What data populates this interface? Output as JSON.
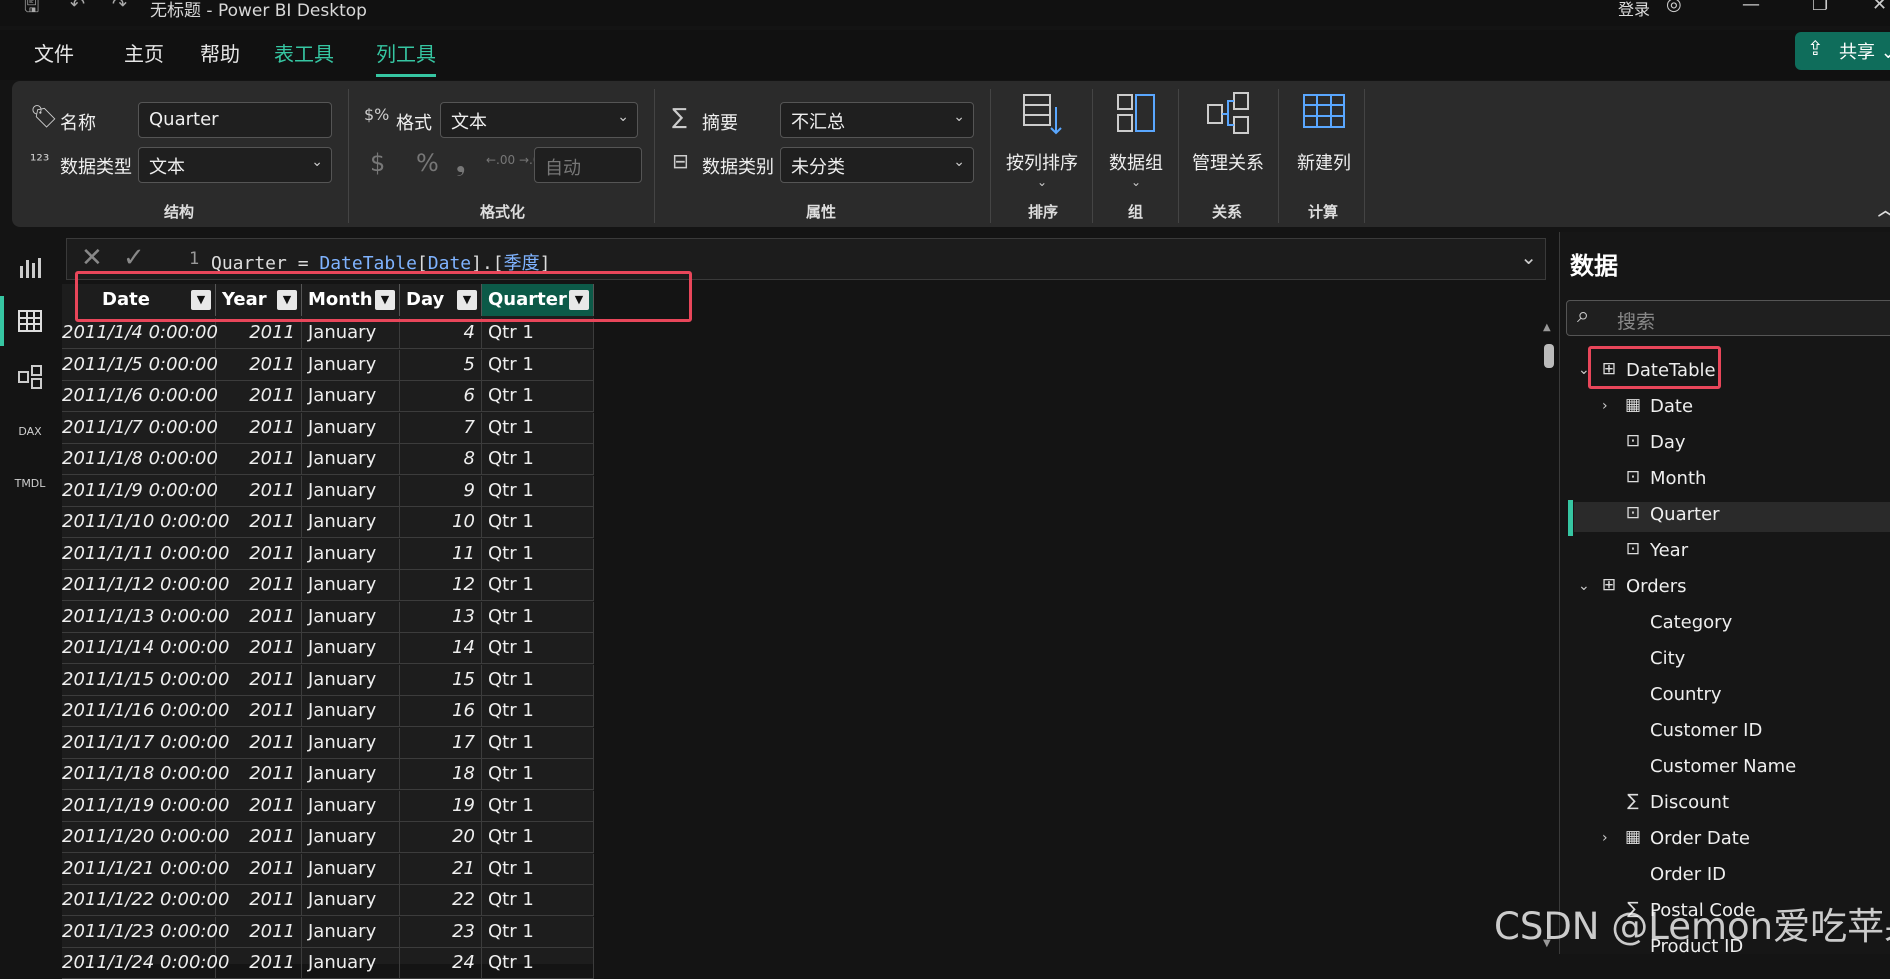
{
  "window": {
    "title": "无标题 - Power BI Desktop",
    "login": "登录",
    "icons": [
      "save-icon",
      "undo-icon",
      "redo-icon"
    ],
    "min": "—",
    "max": "❐",
    "close": "✕"
  },
  "menu": {
    "file": "文件",
    "home": "主页",
    "help": "帮助",
    "table_tools": "表工具",
    "column_tools": "列工具"
  },
  "share": {
    "label": "共享",
    "chevron": "⌄"
  },
  "ribbon": {
    "name_label": "名称",
    "name_value": "Quarter",
    "datatype_label": "数据类型",
    "datatype_value": "文本",
    "structure_group": "结构",
    "format_label": "格式",
    "format_value": "文本",
    "currency": "$",
    "percent": "%",
    "comma": "❟",
    "decimals": "←.00 →.0",
    "decimal_value": "自动",
    "formatting_group": "格式化",
    "summary_label": "摘要",
    "summary_value": "不汇总",
    "category_label": "数据类别",
    "category_value": "未分类",
    "properties_group": "属性",
    "sort_label": "按列排序",
    "sort_group": "排序",
    "groups_label": "数据组",
    "groups_group": "组",
    "rel_label": "管理关系",
    "rel_group": "关系",
    "newcol_label": "新建列",
    "newcol_group": "计算",
    "collapse": "︿"
  },
  "formula": {
    "line": "1",
    "parts": {
      "a": "Quarter = ",
      "b": "DateTable",
      "c": "[",
      "d": "Date",
      "e": "].[",
      "f": "季度",
      "g": "]"
    }
  },
  "grid": {
    "columns": [
      "Date",
      "Year",
      "Month",
      "Day",
      "Quarter"
    ],
    "rows": [
      [
        "2011/1/4 0:00:00",
        "2011",
        "January",
        "4",
        "Qtr 1"
      ],
      [
        "2011/1/5 0:00:00",
        "2011",
        "January",
        "5",
        "Qtr 1"
      ],
      [
        "2011/1/6 0:00:00",
        "2011",
        "January",
        "6",
        "Qtr 1"
      ],
      [
        "2011/1/7 0:00:00",
        "2011",
        "January",
        "7",
        "Qtr 1"
      ],
      [
        "2011/1/8 0:00:00",
        "2011",
        "January",
        "8",
        "Qtr 1"
      ],
      [
        "2011/1/9 0:00:00",
        "2011",
        "January",
        "9",
        "Qtr 1"
      ],
      [
        "2011/1/10 0:00:00",
        "2011",
        "January",
        "10",
        "Qtr 1"
      ],
      [
        "2011/1/11 0:00:00",
        "2011",
        "January",
        "11",
        "Qtr 1"
      ],
      [
        "2011/1/12 0:00:00",
        "2011",
        "January",
        "12",
        "Qtr 1"
      ],
      [
        "2011/1/13 0:00:00",
        "2011",
        "January",
        "13",
        "Qtr 1"
      ],
      [
        "2011/1/14 0:00:00",
        "2011",
        "January",
        "14",
        "Qtr 1"
      ],
      [
        "2011/1/15 0:00:00",
        "2011",
        "January",
        "15",
        "Qtr 1"
      ],
      [
        "2011/1/16 0:00:00",
        "2011",
        "January",
        "16",
        "Qtr 1"
      ],
      [
        "2011/1/17 0:00:00",
        "2011",
        "January",
        "17",
        "Qtr 1"
      ],
      [
        "2011/1/18 0:00:00",
        "2011",
        "January",
        "18",
        "Qtr 1"
      ],
      [
        "2011/1/19 0:00:00",
        "2011",
        "January",
        "19",
        "Qtr 1"
      ],
      [
        "2011/1/20 0:00:00",
        "2011",
        "January",
        "20",
        "Qtr 1"
      ],
      [
        "2011/1/21 0:00:00",
        "2011",
        "January",
        "21",
        "Qtr 1"
      ],
      [
        "2011/1/22 0:00:00",
        "2011",
        "January",
        "22",
        "Qtr 1"
      ],
      [
        "2011/1/23 0:00:00",
        "2011",
        "January",
        "23",
        "Qtr 1"
      ],
      [
        "2011/1/24 0:00:00",
        "2011",
        "January",
        "24",
        "Qtr 1"
      ]
    ]
  },
  "data_pane": {
    "title": "数据",
    "search_placeholder": "搜索",
    "items": [
      {
        "label": "DateTable",
        "icon": "table-icon",
        "level": 0,
        "chevron": "⌄"
      },
      {
        "label": "Date",
        "icon": "calendar-icon",
        "level": 1,
        "chevron": "›"
      },
      {
        "label": "Day",
        "icon": "calc-column-icon",
        "level": 1
      },
      {
        "label": "Month",
        "icon": "calc-column-icon",
        "level": 1
      },
      {
        "label": "Quarter",
        "icon": "calc-column-icon",
        "level": 1,
        "active": true
      },
      {
        "label": "Year",
        "icon": "calc-column-icon",
        "level": 1
      },
      {
        "label": "Orders",
        "icon": "table-icon",
        "level": 0,
        "chevron": "⌄"
      },
      {
        "label": "Category",
        "icon": "",
        "level": 1
      },
      {
        "label": "City",
        "icon": "",
        "level": 1
      },
      {
        "label": "Country",
        "icon": "",
        "level": 1
      },
      {
        "label": "Customer ID",
        "icon": "",
        "level": 1
      },
      {
        "label": "Customer Name",
        "icon": "",
        "level": 1
      },
      {
        "label": "Discount",
        "icon": "sigma-icon",
        "level": 1
      },
      {
        "label": "Order Date",
        "icon": "calendar-icon",
        "level": 1,
        "chevron": "›"
      },
      {
        "label": "Order ID",
        "icon": "",
        "level": 1
      },
      {
        "label": "Postal Code",
        "icon": "sigma-icon",
        "level": 1
      },
      {
        "label": "Product ID",
        "icon": "",
        "level": 1
      }
    ]
  },
  "watermark": "CSDN @Lemon爱吃苹果",
  "colors": {
    "accent": "#36c6a2",
    "highlight": "#e8465a",
    "selected_header": "#0c5a48"
  }
}
